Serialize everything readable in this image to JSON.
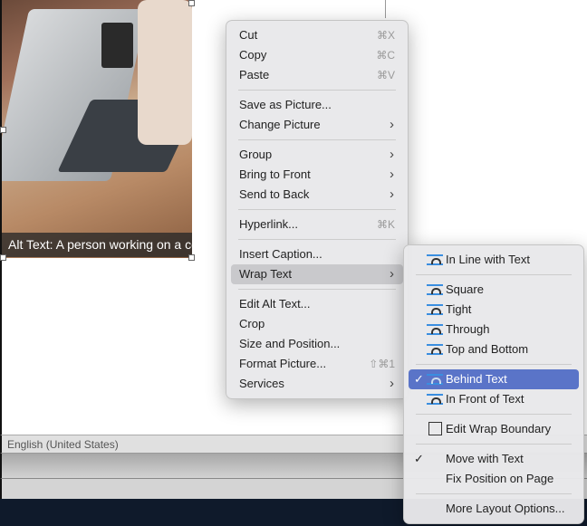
{
  "document": {
    "alt_text_caption": "Alt Text: A person working on a computer"
  },
  "status_bar": {
    "language": "English (United States)"
  },
  "context_menu": {
    "items": [
      {
        "label": "Cut",
        "shortcut": "⌘X"
      },
      {
        "label": "Copy",
        "shortcut": "⌘C"
      },
      {
        "label": "Paste",
        "shortcut": "⌘V"
      },
      {
        "label": "Save as Picture..."
      },
      {
        "label": "Change Picture"
      },
      {
        "label": "Group"
      },
      {
        "label": "Bring to Front"
      },
      {
        "label": "Send to Back"
      },
      {
        "label": "Hyperlink...",
        "shortcut": "⌘K"
      },
      {
        "label": "Insert Caption..."
      },
      {
        "label": "Wrap Text"
      },
      {
        "label": "Edit Alt Text..."
      },
      {
        "label": "Crop"
      },
      {
        "label": "Size and Position..."
      },
      {
        "label": "Format Picture...",
        "shortcut": "⇧⌘1"
      },
      {
        "label": "Services"
      }
    ]
  },
  "wrap_submenu": {
    "items": [
      {
        "label": "In Line with Text"
      },
      {
        "label": "Square"
      },
      {
        "label": "Tight"
      },
      {
        "label": "Through"
      },
      {
        "label": "Top and Bottom"
      },
      {
        "label": "Behind Text",
        "checked": true
      },
      {
        "label": "In Front of Text"
      },
      {
        "label": "Edit Wrap Boundary"
      },
      {
        "label": "Move with Text",
        "checked": true
      },
      {
        "label": "Fix Position on Page"
      },
      {
        "label": "More Layout Options..."
      }
    ],
    "check": "✓",
    "arrow": "›"
  },
  "colors": {
    "highlight": "#5a74c8",
    "icon_blue": "#3a8ee0"
  }
}
